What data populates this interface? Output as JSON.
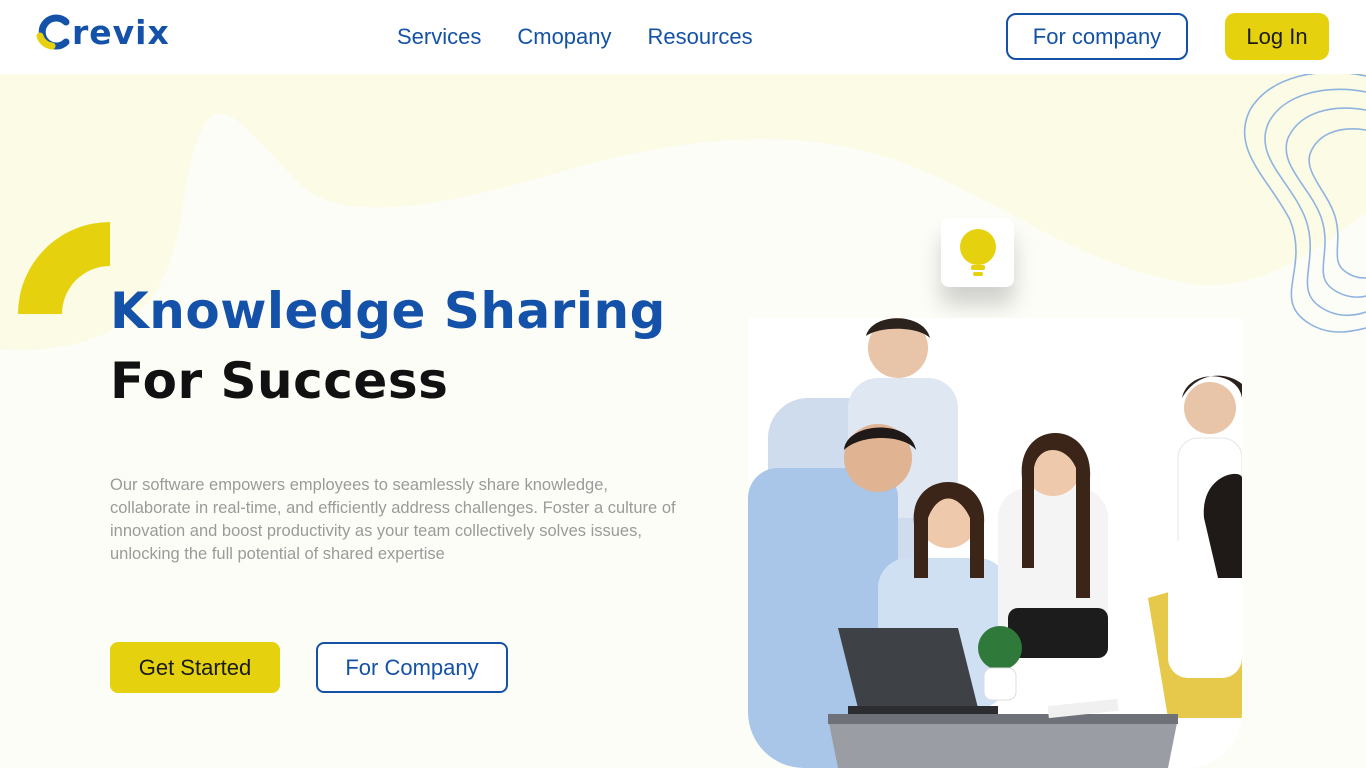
{
  "brand": {
    "name": "revix",
    "primary_color": "#1451a8",
    "accent_color": "#e5d10e"
  },
  "nav": {
    "links": [
      "Services",
      "Cmopany",
      "Resources"
    ],
    "for_company_label": "For company",
    "login_label": "Log In"
  },
  "hero": {
    "title_line1": "Knowledge Sharing",
    "title_line2": "For Success",
    "description": "Our software empowers employees to seamlessly share knowledge, collaborate in real-time, and efficiently address challenges. Foster a culture of innovation and boost productivity as your team collectively solves issues, unlocking the full potential of shared expertise",
    "primary_button": "Get Started",
    "secondary_button": "For Company"
  },
  "decor": {
    "bulb_icon": "lightbulb-icon",
    "photo_subject": "team-collaborating-photo"
  }
}
